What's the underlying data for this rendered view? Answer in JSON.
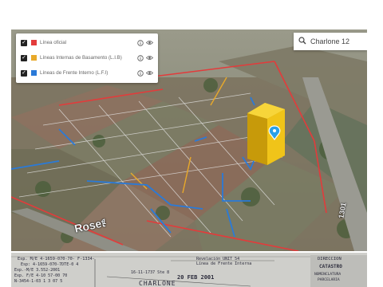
{
  "layers_panel": {
    "items": [
      {
        "label": "Línea oficial",
        "color": "#e33b3b",
        "checked": true
      },
      {
        "label": "Líneas Internas de Basamento (L.I.B)",
        "color": "#e8a92a",
        "checked": true
      },
      {
        "label": "Líneas de Frente Interno (L.F.I)",
        "color": "#2a7ad8",
        "checked": true
      }
    ],
    "checkmark": "✓",
    "info_icon": "info-icon",
    "visibility_icon": "eye-icon"
  },
  "search": {
    "value": "Charlone 12",
    "icon": "search-icon"
  },
  "map": {
    "location_pin_icon": "map-pin-icon",
    "street_labels": [
      "Roset",
      "1301",
      "1"
    ],
    "colors": {
      "linea_oficial": "#e33b3b",
      "basamento": "#e8a92a",
      "frente_interno": "#2a7ad8",
      "building_highlight": "#f0c419"
    }
  },
  "document": {
    "lines": [
      "Esp. M/E 4-1659-070-70-  F-1334-",
      "Esp: 4-1659-070-7DTE-0 4",
      "Exp.-M/E 3.552-2001",
      "Exp. F/E 4-10 57-00 70",
      "N-3454-1-03 1 3 07 5",
      "16-11-1737 Ste 8",
      "20 FEB 2001",
      "Revelación UNIT 54",
      "Línea de Frente Interna",
      "CHARLONE",
      "DIRECCION",
      "CATASTRO",
      "NOMENCLATURA",
      "PARCELARIA"
    ]
  }
}
